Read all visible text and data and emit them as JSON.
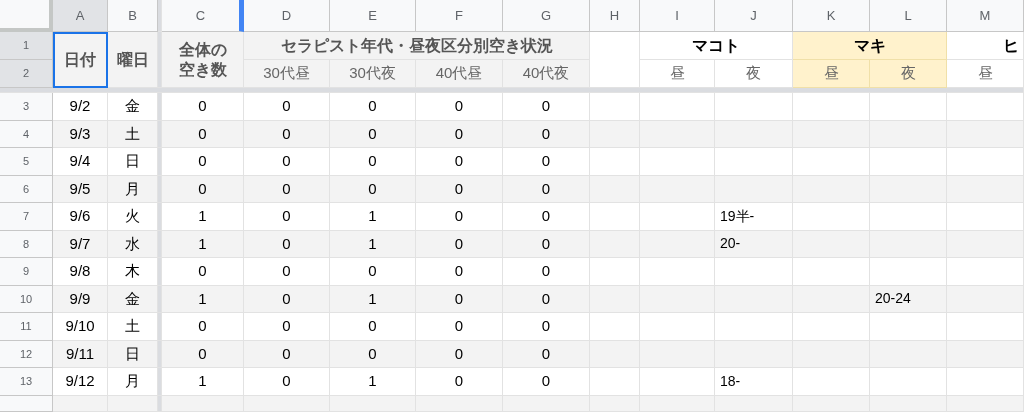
{
  "columns": [
    {
      "letter": "A",
      "selected": true
    },
    {
      "letter": "B",
      "selected": false
    },
    {
      "letter": "C",
      "selected": false
    },
    {
      "letter": "D",
      "selected": false
    },
    {
      "letter": "E",
      "selected": false
    },
    {
      "letter": "F",
      "selected": false
    },
    {
      "letter": "G",
      "selected": false
    },
    {
      "letter": "H",
      "selected": false
    },
    {
      "letter": "I",
      "selected": false
    },
    {
      "letter": "J",
      "selected": false
    },
    {
      "letter": "K",
      "selected": false
    },
    {
      "letter": "L",
      "selected": false
    },
    {
      "letter": "M",
      "selected": false
    }
  ],
  "header_rows": [
    {
      "number": "1",
      "selected": true
    },
    {
      "number": "2",
      "selected": true
    }
  ],
  "header": {
    "date_label": "日付",
    "weekday_label": "曜日",
    "total_label": [
      "全体の",
      "空き数"
    ],
    "group_title": "セラピスト年代・昼夜区分別空き状況",
    "subcolumns": [
      "30代昼",
      "30代夜",
      "40代昼",
      "40代夜"
    ]
  },
  "therapists": [
    {
      "name": "マコト",
      "highlighted": false,
      "shifts": [
        "昼",
        "夜"
      ]
    },
    {
      "name": "マキ",
      "highlighted": true,
      "shifts": [
        "昼",
        "夜"
      ]
    },
    {
      "name": "ヒ",
      "highlighted": false,
      "shifts": [
        "昼"
      ]
    }
  ],
  "rows": [
    {
      "number": "3",
      "date": "9/2",
      "weekday": "金",
      "total": "0",
      "counts": [
        "0",
        "0",
        "0",
        "0"
      ]
    },
    {
      "number": "4",
      "date": "9/3",
      "weekday": "土",
      "total": "0",
      "counts": [
        "0",
        "0",
        "0",
        "0"
      ]
    },
    {
      "number": "5",
      "date": "9/4",
      "weekday": "日",
      "total": "0",
      "counts": [
        "0",
        "0",
        "0",
        "0"
      ]
    },
    {
      "number": "6",
      "date": "9/5",
      "weekday": "月",
      "total": "0",
      "counts": [
        "0",
        "0",
        "0",
        "0"
      ]
    },
    {
      "number": "7",
      "date": "9/6",
      "weekday": "火",
      "total": "1",
      "counts": [
        "0",
        "1",
        "0",
        "0"
      ],
      "slots": {
        "J": "19半-"
      }
    },
    {
      "number": "8",
      "date": "9/7",
      "weekday": "水",
      "total": "1",
      "counts": [
        "0",
        "1",
        "0",
        "0"
      ],
      "slots": {
        "J": "20-"
      }
    },
    {
      "number": "9",
      "date": "9/8",
      "weekday": "木",
      "total": "0",
      "counts": [
        "0",
        "0",
        "0",
        "0"
      ]
    },
    {
      "number": "10",
      "date": "9/9",
      "weekday": "金",
      "total": "1",
      "counts": [
        "0",
        "1",
        "0",
        "0"
      ],
      "slots": {
        "L": "20-24"
      }
    },
    {
      "number": "11",
      "date": "9/10",
      "weekday": "土",
      "total": "0",
      "counts": [
        "0",
        "0",
        "0",
        "0"
      ]
    },
    {
      "number": "12",
      "date": "9/11",
      "weekday": "日",
      "total": "0",
      "counts": [
        "0",
        "0",
        "0",
        "0"
      ]
    },
    {
      "number": "13",
      "date": "9/12",
      "weekday": "月",
      "total": "1",
      "counts": [
        "0",
        "1",
        "0",
        "0"
      ],
      "slots": {
        "J": "18-"
      }
    }
  ]
}
